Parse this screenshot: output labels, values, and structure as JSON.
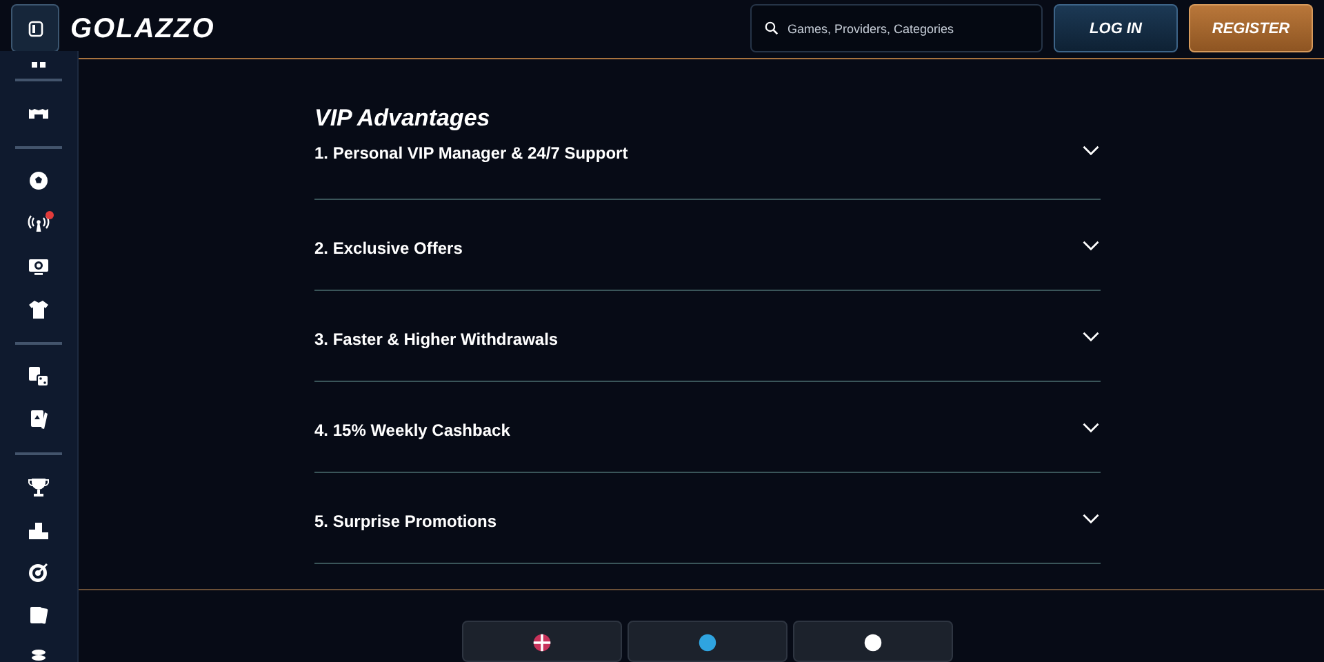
{
  "header": {
    "logo": "GOLAZZO",
    "search": {
      "placeholder": "Games, Providers, Categories"
    },
    "buttons": [
      {
        "label": "LOG IN",
        "kind": "login"
      },
      {
        "label": "REGISTER",
        "kind": "register"
      }
    ]
  },
  "sidebar": {
    "groups": [
      [
        {
          "kind": "partial",
          "alert": false
        }
      ],
      [
        {
          "kind": "stadium",
          "alert": false
        }
      ],
      [
        {
          "kind": "ball",
          "alert": false
        },
        {
          "kind": "live",
          "alert": true
        },
        {
          "kind": "tv",
          "alert": false
        },
        {
          "kind": "shirt",
          "alert": false
        }
      ],
      [
        {
          "kind": "dice",
          "alert": false
        },
        {
          "kind": "card",
          "alert": false
        }
      ],
      [
        {
          "kind": "trophy",
          "alert": false
        },
        {
          "kind": "podium",
          "alert": false
        },
        {
          "kind": "target",
          "alert": false
        },
        {
          "kind": "cards",
          "alert": false
        },
        {
          "kind": "coins",
          "alert": false
        }
      ]
    ]
  },
  "section": {
    "title": "VIP Advantages",
    "items": [
      {
        "title": "1. Personal VIP Manager & 24/7 Support",
        "expanded": false
      },
      {
        "title": "2. Exclusive Offers",
        "expanded": false
      },
      {
        "title": "3. Faster & Higher Withdrawals",
        "expanded": false
      },
      {
        "title": "4. 15% Weekly Cashback",
        "expanded": false
      },
      {
        "title": "5. Surprise Promotions",
        "expanded": false
      }
    ]
  },
  "footer": {
    "buttons": [
      {
        "kind": "flag"
      },
      {
        "kind": "telegram"
      },
      {
        "kind": "chat"
      }
    ]
  }
}
